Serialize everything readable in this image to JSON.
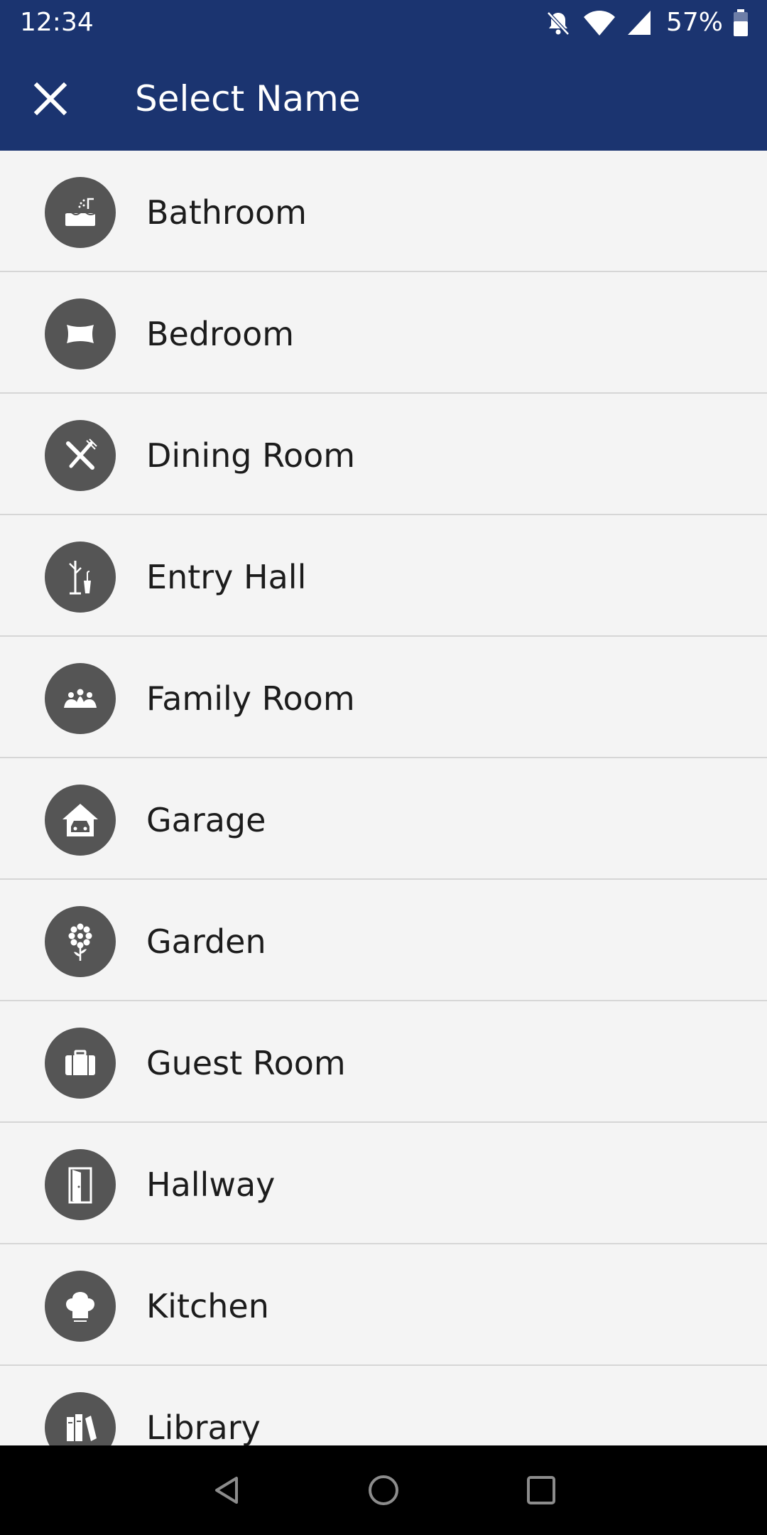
{
  "status_bar": {
    "time": "12:34",
    "battery_percent": "57%",
    "icons": [
      "bell-off-icon",
      "wifi-icon",
      "signal-icon",
      "battery-icon"
    ]
  },
  "app_bar": {
    "close_icon": "close-icon",
    "title": "Select Name"
  },
  "rooms": [
    {
      "label": "Bathroom",
      "icon": "bathtub-icon"
    },
    {
      "label": "Bedroom",
      "icon": "pillow-icon"
    },
    {
      "label": "Dining Room",
      "icon": "fork-knife-icon"
    },
    {
      "label": "Entry Hall",
      "icon": "coat-rack-icon"
    },
    {
      "label": "Family Room",
      "icon": "family-icon"
    },
    {
      "label": "Garage",
      "icon": "garage-car-icon"
    },
    {
      "label": "Garden",
      "icon": "flower-icon"
    },
    {
      "label": "Guest Room",
      "icon": "suitcase-icon"
    },
    {
      "label": "Hallway",
      "icon": "door-icon"
    },
    {
      "label": "Kitchen",
      "icon": "chef-hat-icon"
    },
    {
      "label": "Library",
      "icon": "books-icon"
    }
  ],
  "nav_bar": {
    "icons": [
      "back-icon",
      "home-icon",
      "recents-icon"
    ]
  },
  "colors": {
    "header": "#1b3470",
    "list_bg": "#f4f4f4",
    "icon_circle": "#555555",
    "divider": "#d6d6d6",
    "text": "#1c1c1c"
  }
}
